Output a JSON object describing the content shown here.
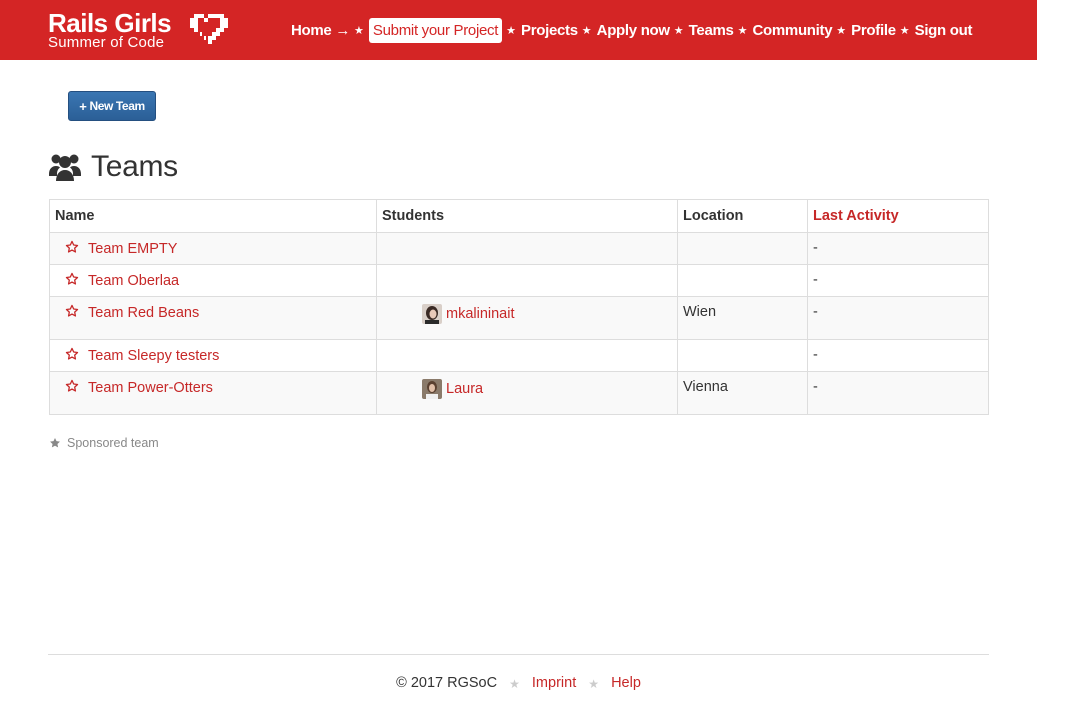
{
  "header": {
    "logo_title": "Rails Girls",
    "logo_subtitle": "Summer of Code",
    "nav": [
      {
        "label": "Home →",
        "active": false
      },
      {
        "label": "Submit your Project",
        "active": true
      },
      {
        "label": "Projects",
        "active": false
      },
      {
        "label": "Apply now",
        "active": false
      },
      {
        "label": "Teams",
        "active": false
      },
      {
        "label": "Community",
        "active": false
      },
      {
        "label": "Profile",
        "active": false
      },
      {
        "label": "Sign out",
        "active": false
      }
    ]
  },
  "actions": {
    "new_team_label": "New Team"
  },
  "page": {
    "title": "Teams"
  },
  "table": {
    "headers": {
      "name": "Name",
      "students": "Students",
      "location": "Location",
      "last_activity": "Last Activity"
    },
    "rows": [
      {
        "name": "Team EMPTY",
        "student": "",
        "location": "",
        "last_activity": "-"
      },
      {
        "name": "Team Oberlaa",
        "student": "",
        "location": "",
        "last_activity": "-"
      },
      {
        "name": "Team Red Beans",
        "student": "mkalininait",
        "location": "Wien",
        "last_activity": "-"
      },
      {
        "name": "Team Sleepy testers",
        "student": "",
        "location": "",
        "last_activity": "-"
      },
      {
        "name": "Team Power-Otters",
        "student": "Laura",
        "location": "Vienna",
        "last_activity": "-"
      }
    ]
  },
  "legend": {
    "sponsored_label": "Sponsored team"
  },
  "footer": {
    "copyright": "© 2017 RGSoC",
    "imprint": "Imprint",
    "help": "Help"
  },
  "colors": {
    "brand_red": "#d42525",
    "link_red": "#c62828",
    "button_blue": "#2b5f97"
  }
}
